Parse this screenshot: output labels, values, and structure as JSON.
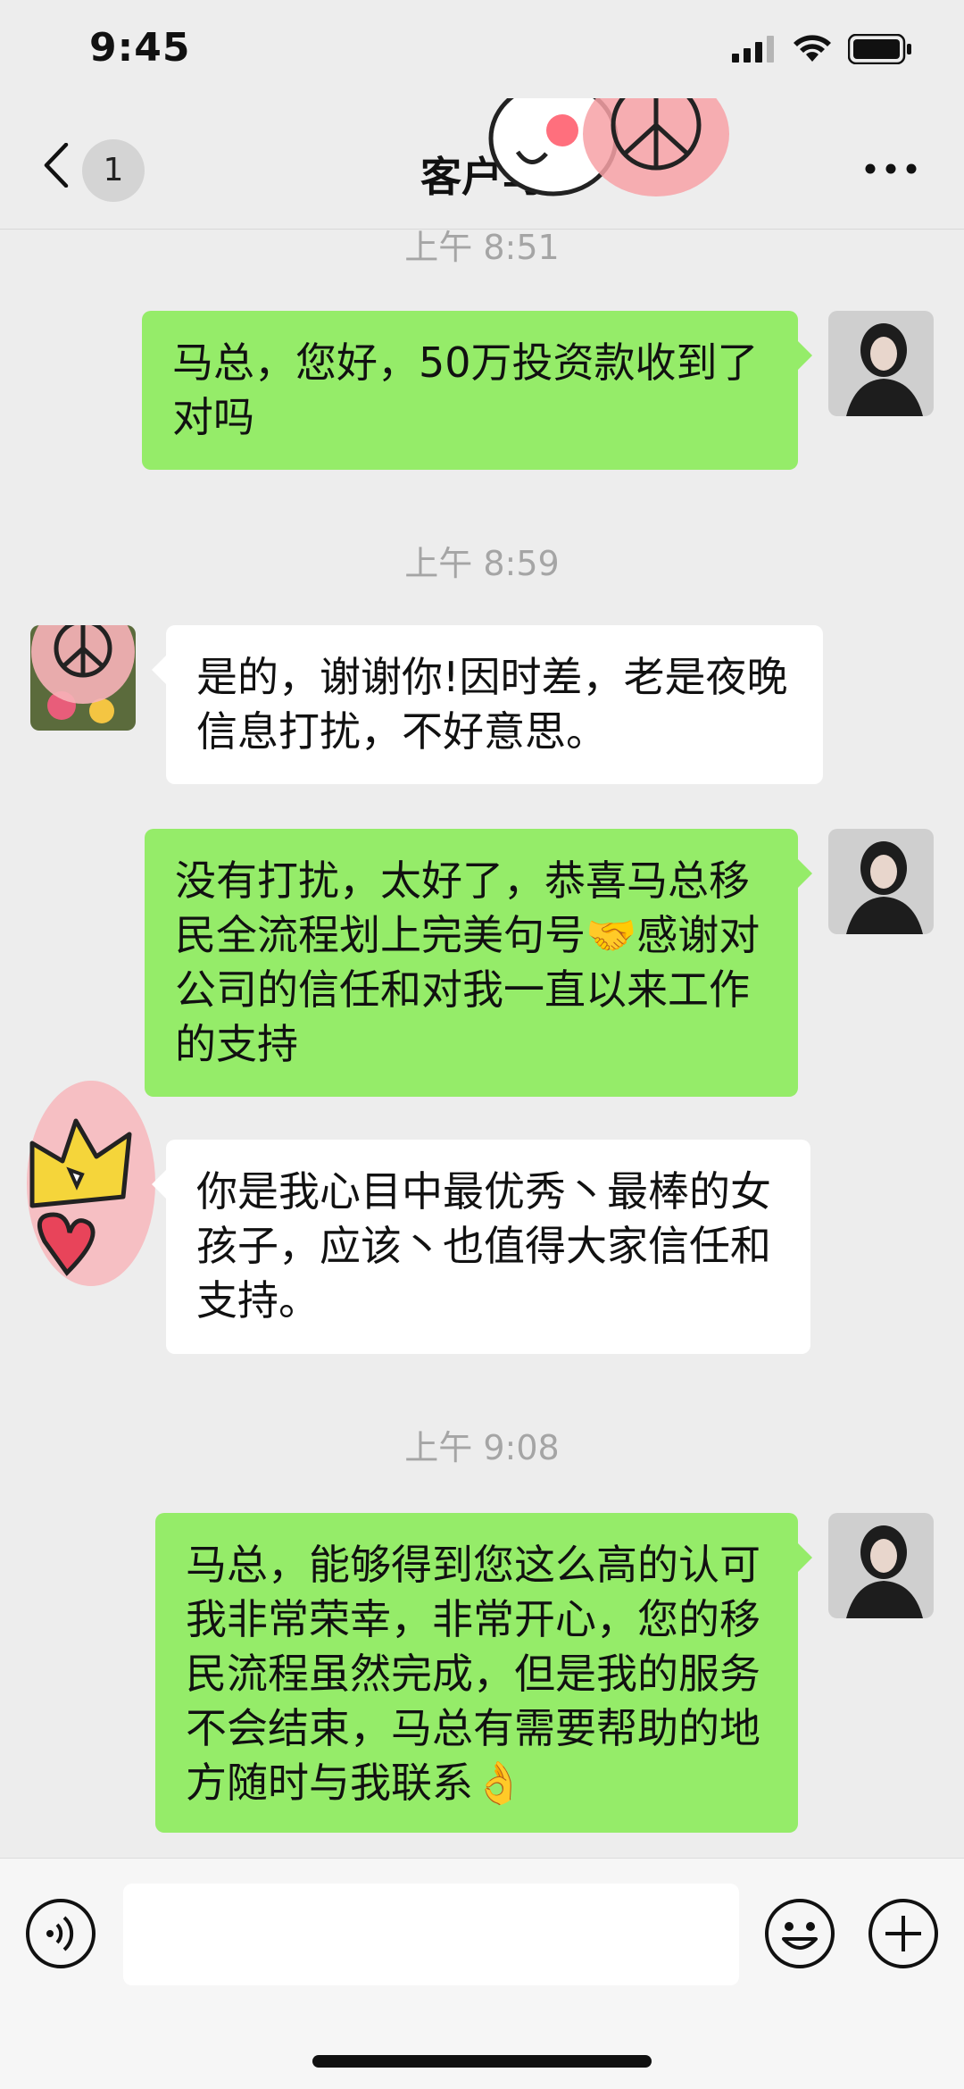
{
  "status_bar": {
    "time": "9:45",
    "icons": [
      "signal-icon",
      "wifi-icon",
      "battery-icon"
    ]
  },
  "nav": {
    "back_icon": "chevron-left-icon",
    "unread_count": "1",
    "title": "客户马",
    "more_icon": "more-dots-icon"
  },
  "messages": [
    {
      "type": "time",
      "text": "上午 8:51"
    },
    {
      "type": "out",
      "text": "马总，您好，50万投资款收到了对吗"
    },
    {
      "type": "time",
      "text": "上午 8:59"
    },
    {
      "type": "in",
      "text": "是的，谢谢你!因时差，老是夜晚信息打扰，不好意思。"
    },
    {
      "type": "out",
      "text": "没有打扰，太好了，恭喜马总移民全流程划上完美句号🤝感谢对公司的信任和对我一直以来工作的支持"
    },
    {
      "type": "in",
      "text": "你是我心目中最优秀丶最棒的女孩子，应该丶也值得大家信任和支持。"
    },
    {
      "type": "time",
      "text": "上午 9:08"
    },
    {
      "type": "out",
      "text": "马总，能够得到您这么高的认可我非常荣幸，非常开心，您的移民流程虽然完成，但是我的服务不会结束，马总有需要帮助的地方随时与我联系👌"
    }
  ],
  "input_bar": {
    "voice_icon": "voice-icon",
    "text_value": "",
    "emoji_icon": "emoji-icon",
    "plus_icon": "plus-icon"
  },
  "colors": {
    "background": "#ededed",
    "outgoing_bubble": "#95ec69",
    "incoming_bubble": "#ffffff",
    "timestamp": "#a5a5a5"
  }
}
